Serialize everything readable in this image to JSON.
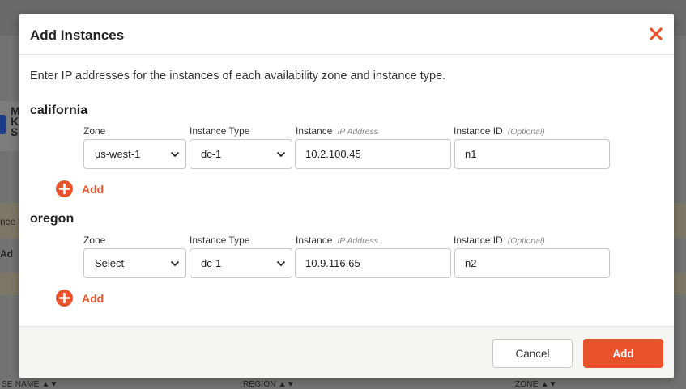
{
  "background": {
    "card_text": "M\nK\nS",
    "alert_text": "nce t",
    "add_text": "Ad",
    "columns": [
      "SE NAME",
      "REGION",
      "ZONE"
    ]
  },
  "modal": {
    "title": "Add Instances",
    "intro": "Enter IP addresses for the instances of each availability zone and instance type.",
    "labels": {
      "zone": "Zone",
      "instance_type": "Instance Type",
      "instance": "Instance",
      "ip_hint": "IP Address",
      "instance_id": "Instance ID",
      "optional_hint": "(Optional)"
    },
    "sections": [
      {
        "name": "california",
        "zone_value": "us-west-1",
        "instance_type_value": "dc-1",
        "ip_value": "10.2.100.45",
        "instance_id_value": "n1",
        "add_label": "Add"
      },
      {
        "name": "oregon",
        "zone_value": "Select",
        "instance_type_value": "dc-1",
        "ip_value": "10.9.116.65",
        "instance_id_value": "n2",
        "add_label": "Add"
      }
    ],
    "footer": {
      "cancel_label": "Cancel",
      "add_label": "Add"
    }
  },
  "colors": {
    "accent": "#e8532b",
    "overlay": "#727272"
  },
  "icons": {
    "close": "close-icon",
    "plus": "plus-circle-icon",
    "chevron": "chevron-down-icon"
  }
}
